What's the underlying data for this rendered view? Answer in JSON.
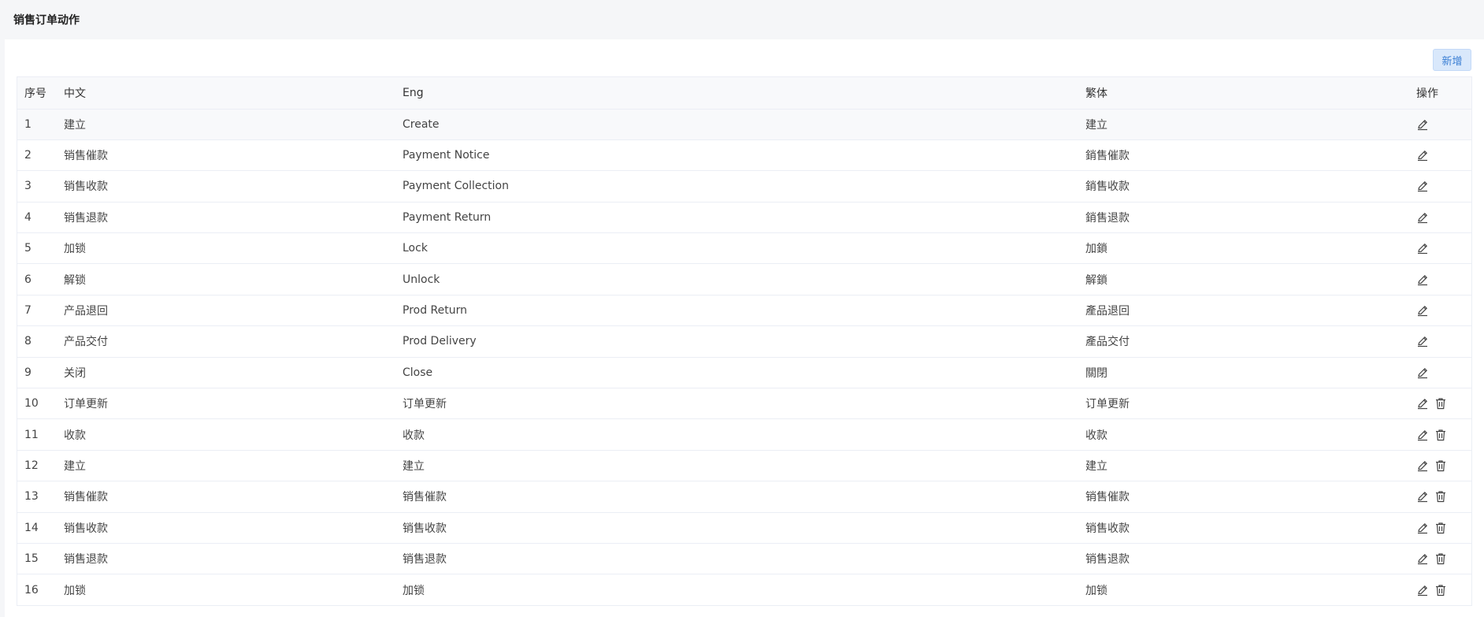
{
  "page": {
    "title": "销售订单动作"
  },
  "toolbar": {
    "add_label": "新增"
  },
  "table": {
    "headers": {
      "no": "序号",
      "zh": "中文",
      "en": "Eng",
      "tw": "繁体",
      "op": "操作"
    },
    "rows": [
      {
        "no": "1",
        "zh": "建立",
        "en": "Create",
        "tw": "建立",
        "deletable": false
      },
      {
        "no": "2",
        "zh": "销售催款",
        "en": "Payment Notice",
        "tw": "銷售催款",
        "deletable": false
      },
      {
        "no": "3",
        "zh": "销售收款",
        "en": "Payment Collection",
        "tw": "銷售收款",
        "deletable": false
      },
      {
        "no": "4",
        "zh": "销售退款",
        "en": "Payment Return",
        "tw": "銷售退款",
        "deletable": false
      },
      {
        "no": "5",
        "zh": "加锁",
        "en": "Lock",
        "tw": "加鎖",
        "deletable": false
      },
      {
        "no": "6",
        "zh": "解锁",
        "en": "Unlock",
        "tw": "解鎖",
        "deletable": false
      },
      {
        "no": "7",
        "zh": "产品退回",
        "en": "Prod Return",
        "tw": "產品退回",
        "deletable": false
      },
      {
        "no": "8",
        "zh": "产品交付",
        "en": "Prod Delivery",
        "tw": "產品交付",
        "deletable": false
      },
      {
        "no": "9",
        "zh": "关闭",
        "en": "Close",
        "tw": "關閉",
        "deletable": false
      },
      {
        "no": "10",
        "zh": "订单更新",
        "en": "订单更新",
        "tw": "订单更新",
        "deletable": true
      },
      {
        "no": "11",
        "zh": "收款",
        "en": "收款",
        "tw": "收款",
        "deletable": true
      },
      {
        "no": "12",
        "zh": "建立",
        "en": "建立",
        "tw": "建立",
        "deletable": true
      },
      {
        "no": "13",
        "zh": "销售催款",
        "en": "销售催款",
        "tw": "销售催款",
        "deletable": true
      },
      {
        "no": "14",
        "zh": "销售收款",
        "en": "销售收款",
        "tw": "销售收款",
        "deletable": true
      },
      {
        "no": "15",
        "zh": "销售退款",
        "en": "销售退款",
        "tw": "销售退款",
        "deletable": true
      },
      {
        "no": "16",
        "zh": "加锁",
        "en": "加锁",
        "tw": "加锁",
        "deletable": true
      }
    ]
  },
  "icons": {
    "edit": "edit-icon",
    "delete": "trash-icon"
  }
}
